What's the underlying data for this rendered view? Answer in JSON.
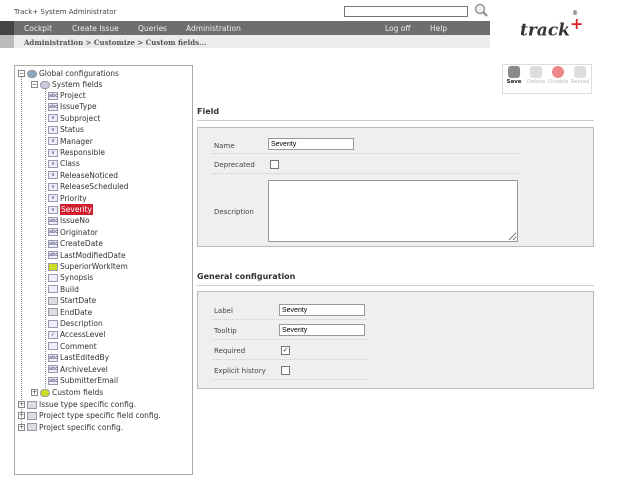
{
  "app_title": "Track+ System Administrator",
  "search": {
    "value": ""
  },
  "nav": {
    "items": [
      "Cockpit",
      "Create Issue",
      "Queries",
      "Administration"
    ],
    "right": [
      "Log off",
      "Help"
    ]
  },
  "breadcrumb": "Administration  >  Customize  >  Custom fields...",
  "logo": {
    "text": "track",
    "plus": "+",
    "reg": "®"
  },
  "tree": {
    "root": "Global configurations",
    "system_fields": "System fields",
    "fields": [
      {
        "label": "Project",
        "icon": "abc"
      },
      {
        "label": "IssueType",
        "icon": "abc"
      },
      {
        "label": "Subproject",
        "icon": "v"
      },
      {
        "label": "Status",
        "icon": "v"
      },
      {
        "label": "Manager",
        "icon": "v"
      },
      {
        "label": "Responsible",
        "icon": "v"
      },
      {
        "label": "Class",
        "icon": "v"
      },
      {
        "label": "ReleaseNoticed",
        "icon": "v"
      },
      {
        "label": "ReleaseScheduled",
        "icon": "v"
      },
      {
        "label": "Priority",
        "icon": "v"
      },
      {
        "label": "Severity",
        "icon": "v",
        "selected": true
      },
      {
        "label": "IssueNo",
        "icon": "abc"
      },
      {
        "label": "Originator",
        "icon": "abc"
      },
      {
        "label": "CreateDate",
        "icon": "abc"
      },
      {
        "label": "LastModifiedDate",
        "icon": "abc"
      },
      {
        "label": "SuperiorWorkItem",
        "icon": "link"
      },
      {
        "label": "Synopsis",
        "icon": ""
      },
      {
        "label": "Build",
        "icon": ""
      },
      {
        "label": "StartDate",
        "icon": "date"
      },
      {
        "label": "EndDate",
        "icon": "date"
      },
      {
        "label": "Description",
        "icon": ""
      },
      {
        "label": "AccessLevel",
        "icon": "check"
      },
      {
        "label": "Comment",
        "icon": ""
      },
      {
        "label": "LastEditedBy",
        "icon": "abc"
      },
      {
        "label": "ArchiveLevel",
        "icon": "abc"
      },
      {
        "label": "SubmitterEmail",
        "icon": "abc"
      }
    ],
    "custom_fields": "Custom fields",
    "others": [
      "Issue type specific config.",
      "Project type specific field config.",
      "Project specific config."
    ]
  },
  "toolbar": {
    "save": "Save",
    "delete": "Delete",
    "disable": "Disable",
    "reload": "Reload"
  },
  "field": {
    "heading": "Field",
    "name_label": "Name",
    "name_value": "Severity",
    "deprecated_label": "Deprecated",
    "deprecated": false,
    "description_label": "Description",
    "description_value": ""
  },
  "general": {
    "heading": "General configuration",
    "label_label": "Label",
    "label_value": "Severity",
    "tooltip_label": "Tooltip",
    "tooltip_value": "Severity",
    "required_label": "Required",
    "required": true,
    "history_label": "Explicit history",
    "history": false
  }
}
